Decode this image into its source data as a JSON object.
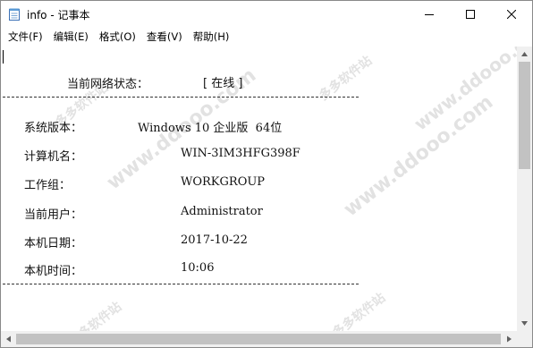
{
  "window": {
    "title": "info - 记事本"
  },
  "menu": {
    "items": [
      "文件(F)",
      "编辑(E)",
      "格式(O)",
      "查看(V)",
      "帮助(H)"
    ]
  },
  "content": {
    "status_label": "当前网络状态：",
    "status_value": "[ 在线 ]",
    "rows": [
      {
        "label": "系统版本：",
        "value": "Windows 10 企业版  64位"
      },
      {
        "label": "计算机名：",
        "value": "WIN-3IM3HFG398F"
      },
      {
        "label": "工作组：",
        "value": "WORKGROUP"
      },
      {
        "label": "当前用户：",
        "value": "Administrator"
      },
      {
        "label": "本机日期：",
        "value": "2017-10-22"
      },
      {
        "label": "本机时间：",
        "value": "10:06"
      }
    ]
  },
  "watermark": {
    "text": "www.ddooo.com",
    "text_cn": "多多软件站"
  },
  "icons": {
    "app": "notepad-icon",
    "minimize": "minimize-icon",
    "maximize": "maximize-icon",
    "close": "close-icon"
  }
}
